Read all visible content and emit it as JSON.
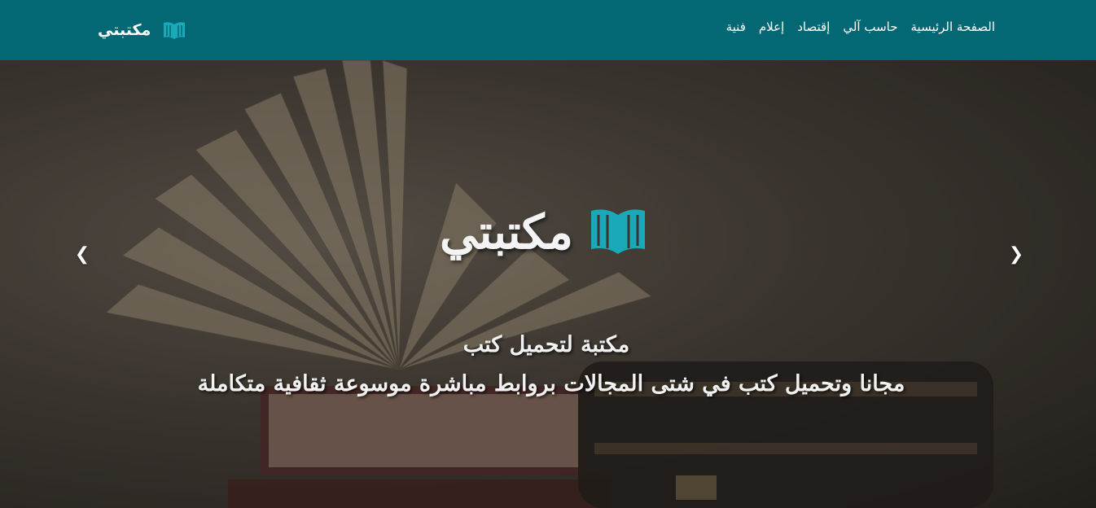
{
  "navbar": {
    "brand_name": "مكتبتي",
    "brand_icon": "open-book-icon",
    "links": [
      {
        "label": "الصفحة الرئيسية"
      },
      {
        "label": "حاسب آلي"
      },
      {
        "label": "إقتصاد"
      },
      {
        "label": "إعلام"
      },
      {
        "label": "فنية"
      }
    ]
  },
  "hero": {
    "logo_text": "مكتبتي",
    "logo_icon": "open-book-icon",
    "line1": "مكتبة لتحميل كتب",
    "line2": "مجانا وتحميل كتب في شتى المجالات بروابط مباشرة موسوعة ثقافية متكاملة"
  },
  "carousel": {
    "prev_icon": "chevron-left-icon",
    "next_icon": "chevron-right-icon"
  },
  "colors": {
    "navbar_bg": "#036873",
    "accent_teal": "#1aa9b8",
    "text_light": "#ffffff"
  }
}
